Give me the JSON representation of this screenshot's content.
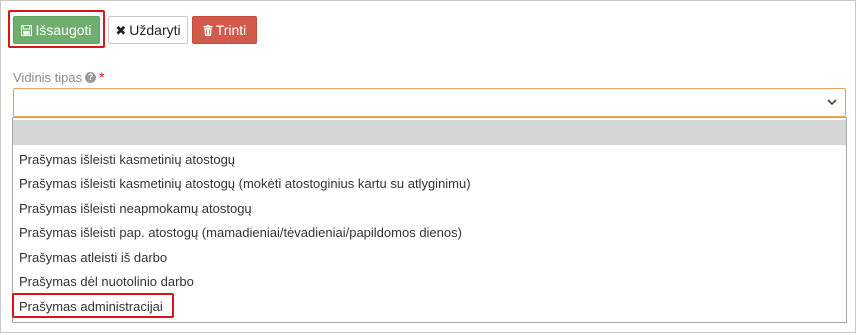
{
  "toolbar": {
    "save_label": "Išsaugoti",
    "close_label": "Uždaryti",
    "delete_label": "Trinti"
  },
  "field": {
    "label": "Vidinis tipas",
    "required_mark": "*",
    "value": ""
  },
  "dropdown": {
    "options": [
      "",
      "Prašymas išleisti kasmetinių atostogų",
      "Prašymas išleisti kasmetinių atostogų (mokėti atostoginius kartu su atlyginimu)",
      "Prašymas išleisti neapmokamų atostogų",
      "Prašymas išleisti pap. atostogų (mamadieniai/tėvadieniai/papildomos dienos)",
      "Prašymas atleisti iš darbo",
      "Prašymas dėl nuotolinio darbo",
      "Prašymas administracijai"
    ],
    "selected_index": 0
  },
  "colors": {
    "save": "#6fae6f",
    "delete": "#d25a4a",
    "highlight": "#d9141b",
    "focus_border": "#e4a35a"
  },
  "icons": {
    "save": "floppy-disk-icon",
    "close": "close-icon",
    "delete": "trash-icon",
    "help": "question-circle-icon",
    "select": "chevron-down-icon"
  }
}
